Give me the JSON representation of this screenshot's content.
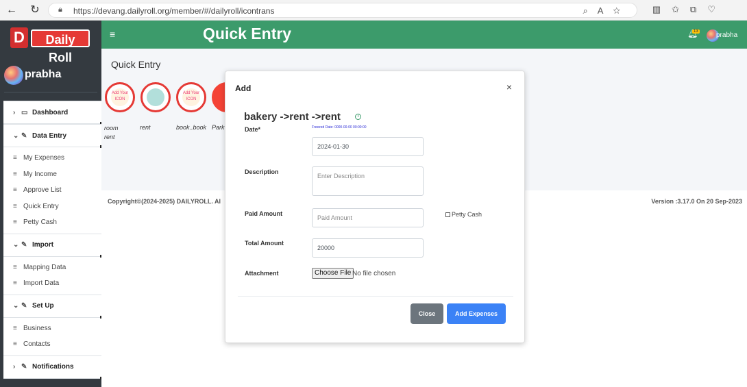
{
  "browser": {
    "url": "https://devang.dailyroll.org/member/#/dailyroll/icontrans"
  },
  "sidebar": {
    "logo_letter": "D",
    "logo_text": "Daily Roll",
    "user_name": "prabha",
    "sections": [
      {
        "label": "Dashboard",
        "items": []
      },
      {
        "label": "Data Entry",
        "items": [
          "My Expenses",
          "My Income",
          "Approve List",
          "Quick Entry",
          "Petty Cash"
        ]
      },
      {
        "label": "Import",
        "items": [
          "Mapping Data",
          "Import Data"
        ]
      },
      {
        "label": "Set Up",
        "items": [
          "Business",
          "Contacts"
        ]
      },
      {
        "label": "Notifications",
        "items": []
      }
    ]
  },
  "topbar": {
    "title": "Quick Entry",
    "badge": "13",
    "user": "prabha"
  },
  "content": {
    "title": "Quick Entry",
    "shortcuts": [
      {
        "label": "room rent",
        "icon_text": "Add Your ICON"
      },
      {
        "label": "rent",
        "icon_text": ""
      },
      {
        "label": "book..book",
        "icon_text": "Add Your ICON"
      },
      {
        "label": "Park",
        "icon_text": ""
      }
    ]
  },
  "footer": {
    "copyright": "Copyright©(2024-2025) DAILYROLL. Al",
    "version": "Version :3.17.0 On 20 Sep-2023"
  },
  "modal": {
    "title": "Add",
    "close_glyph": "×",
    "path": "bakery ->rent ->rent",
    "freezed": "Freezed Date: 0000-00-00 00:00:00",
    "date_label": "Date*",
    "date_value": "2024-01-30",
    "description_label": "Description",
    "description_placeholder": "Enter Description",
    "paid_label": "Paid Amount",
    "paid_placeholder": "Paid Amount",
    "petty_label": "Petty Cash",
    "total_label": "Total Amount",
    "total_value": "20000",
    "attachment_label": "Attachment",
    "file_button": "Choose File",
    "file_text": "No file chosen",
    "close_button": "Close",
    "add_button": "Add Expenses"
  }
}
